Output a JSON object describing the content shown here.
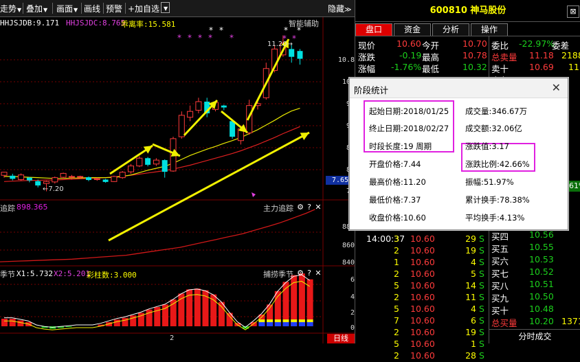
{
  "toolbar": {
    "items": [
      "走势",
      "叠加",
      "画面",
      "画线",
      "预警",
      "+加自选"
    ],
    "hide_label": "隐藏",
    "icon_names": [
      "dropdown-icon",
      "expand-icon"
    ]
  },
  "main_chart": {
    "indicators": [
      "HHJSJDB:9.171",
      "HHJSJDC:8.765",
      "乖离率:15.581"
    ],
    "smart_label": "智能辅助",
    "y_axis": [
      "10.8",
      "10.",
      "9.",
      "9.",
      "8.",
      "8.",
      "7."
    ],
    "price_tag": "7.65",
    "low_label": "7.20",
    "high_label": "11.20",
    "candles": [
      {
        "o": 7.61,
        "c": 7.69,
        "h": 7.7,
        "l": 7.55,
        "up": true
      },
      {
        "o": 7.6,
        "c": 7.52,
        "h": 7.65,
        "l": 7.48,
        "up": false
      },
      {
        "o": 7.5,
        "c": 7.62,
        "h": 7.66,
        "l": 7.47,
        "up": true
      },
      {
        "o": 7.55,
        "c": 7.48,
        "h": 7.57,
        "l": 7.43,
        "up": false
      },
      {
        "o": 7.46,
        "c": 7.35,
        "h": 7.5,
        "l": 7.3,
        "up": false
      },
      {
        "o": 7.4,
        "c": 7.45,
        "h": 7.47,
        "l": 7.2,
        "up": true
      },
      {
        "o": 7.44,
        "c": 7.55,
        "h": 7.58,
        "l": 7.4,
        "up": true
      },
      {
        "o": 7.56,
        "c": 7.66,
        "h": 7.68,
        "l": 7.52,
        "up": true
      },
      {
        "o": 7.57,
        "c": 7.58,
        "h": 7.62,
        "l": 7.5,
        "up": true
      },
      {
        "o": 7.58,
        "c": 7.58,
        "h": 7.6,
        "l": 7.52,
        "up": true
      },
      {
        "o": 7.56,
        "c": 7.49,
        "h": 7.58,
        "l": 7.46,
        "up": false
      },
      {
        "o": 7.5,
        "c": 7.52,
        "h": 7.55,
        "l": 7.47,
        "up": true
      },
      {
        "o": 7.5,
        "c": 7.44,
        "h": 7.52,
        "l": 7.42,
        "up": false
      },
      {
        "o": 7.45,
        "c": 7.58,
        "h": 7.6,
        "l": 7.44,
        "up": true
      },
      {
        "o": 7.55,
        "c": 7.69,
        "h": 7.72,
        "l": 7.52,
        "up": true
      },
      {
        "o": 7.7,
        "c": 7.85,
        "h": 7.9,
        "l": 7.65,
        "up": true
      },
      {
        "o": 7.85,
        "c": 8.05,
        "h": 8.1,
        "l": 7.82,
        "up": true
      },
      {
        "o": 8.05,
        "c": 7.88,
        "h": 8.08,
        "l": 7.84,
        "up": false
      },
      {
        "o": 7.9,
        "c": 8.0,
        "h": 8.05,
        "l": 7.85,
        "up": true
      },
      {
        "o": 8.0,
        "c": 7.7,
        "h": 8.02,
        "l": 7.55,
        "up": false
      },
      {
        "o": 7.72,
        "c": 8.55,
        "h": 8.6,
        "l": 7.7,
        "up": true
      },
      {
        "o": 8.6,
        "c": 9.15,
        "h": 9.25,
        "l": 8.55,
        "up": true
      },
      {
        "o": 9.1,
        "c": 9.25,
        "h": 9.4,
        "l": 9.0,
        "up": true
      },
      {
        "o": 9.28,
        "c": 9.5,
        "h": 9.6,
        "l": 9.2,
        "up": true
      },
      {
        "o": 9.5,
        "c": 9.2,
        "h": 9.6,
        "l": 9.1,
        "up": false
      },
      {
        "o": 9.3,
        "c": 9.48,
        "h": 9.52,
        "l": 9.25,
        "up": true
      },
      {
        "o": 9.4,
        "c": 9.35,
        "h": 9.42,
        "l": 9.28,
        "up": false
      },
      {
        "o": 9.0,
        "c": 8.6,
        "h": 9.02,
        "l": 8.55,
        "up": false
      },
      {
        "o": 8.5,
        "c": 8.8,
        "h": 8.85,
        "l": 8.4,
        "up": true
      },
      {
        "o": 8.7,
        "c": 9.4,
        "h": 9.55,
        "l": 8.65,
        "up": true
      },
      {
        "o": 9.4,
        "c": 9.45,
        "h": 9.5,
        "l": 9.3,
        "up": true
      },
      {
        "o": 9.6,
        "c": 10.35,
        "h": 10.5,
        "l": 9.55,
        "up": true
      },
      {
        "o": 10.3,
        "c": 10.85,
        "h": 10.95,
        "l": 10.25,
        "up": true
      },
      {
        "o": 10.7,
        "c": 11.0,
        "h": 11.2,
        "l": 10.65,
        "up": true
      },
      {
        "o": 10.85,
        "c": 10.65,
        "h": 10.95,
        "l": 10.5,
        "up": false
      },
      {
        "o": 10.8,
        "c": 10.6,
        "h": 10.85,
        "l": 10.45,
        "up": false
      }
    ],
    "ma_yellow": [
      7.58,
      7.58,
      7.57,
      7.56,
      7.55,
      7.54,
      7.53,
      7.53,
      7.54,
      7.54,
      7.55,
      7.55,
      7.55,
      7.56,
      7.58,
      7.62,
      7.68,
      7.74,
      7.79,
      7.84,
      7.92,
      8.02,
      8.12,
      8.2,
      8.28,
      8.35,
      8.43,
      8.5,
      8.58,
      8.68,
      8.78,
      8.9,
      9.02,
      9.15,
      9.26,
      9.33
    ],
    "ma_red": [
      7.45,
      7.46,
      7.47,
      7.48,
      7.48,
      7.49,
      7.49,
      7.5,
      7.51,
      7.52,
      7.53,
      7.54,
      7.55,
      7.57,
      7.59,
      7.61,
      7.64,
      7.67,
      7.7,
      7.73,
      7.77,
      7.82,
      7.87,
      7.93,
      7.99,
      8.05,
      8.11,
      8.17,
      8.24,
      8.32,
      8.4,
      8.49,
      8.58,
      8.68,
      8.77,
      8.86
    ],
    "y_range": [
      7.05,
      11.35
    ]
  },
  "panel2": {
    "title_left": "追踪",
    "value_left": "898.365",
    "title_right": "主力追踪",
    "y_axis": [
      "880",
      "860",
      "840"
    ],
    "line": [
      818,
      818.5,
      819,
      819.5,
      820,
      820.5,
      821,
      821.5,
      822,
      823,
      824,
      825,
      826,
      827,
      828,
      830,
      832,
      834,
      836,
      838,
      840,
      843,
      846,
      849,
      852,
      855,
      858,
      861,
      865,
      869,
      873,
      877,
      882,
      887,
      892,
      898
    ],
    "y_range": [
      816,
      902
    ]
  },
  "panel3": {
    "title_left": "季节",
    "indicators": [
      "X1:5.732",
      "X2:5.201",
      "彩柱数:3.000"
    ],
    "title_right": "捕捞季节",
    "y_axis": [
      "6",
      "4",
      "2",
      "0"
    ],
    "bars": [
      0.9,
      0.9,
      0.7,
      0.5,
      0,
      -0.2,
      -0.3,
      -0.2,
      -0.1,
      0,
      0,
      0,
      0.2,
      0.5,
      0.8,
      1.0,
      1.3,
      1.6,
      2.0,
      2.3,
      2.6,
      3.2,
      3.9,
      4.4,
      4.5,
      4.3,
      3.8,
      2.9,
      1.6,
      0.4,
      -0.3,
      0.5,
      1.4,
      2.6,
      4.2,
      5.3,
      6.1,
      6.3,
      5.6
    ],
    "x_label": "2",
    "tab": "日线"
  },
  "right_panel": {
    "code_name": "600810 神马股份",
    "tabs": [
      "盘口",
      "资金",
      "分析",
      "操作"
    ],
    "active_tab": "盘口",
    "quote_left": [
      {
        "label": "现价",
        "value": "10.60",
        "label2": "今开",
        "value2": "10.70"
      },
      {
        "label": "涨跌",
        "value": "-0.19",
        "label2": "最高",
        "value2": "10.78"
      },
      {
        "label": "涨幅",
        "value": "-1.76%",
        "label2": "最低",
        "value2": "10.32"
      }
    ],
    "quote_right": [
      {
        "label": "委比",
        "value": "-22.97%",
        "label2": "委差"
      },
      {
        "label": "总卖量",
        "value": "11.18",
        "value2": "2188"
      },
      {
        "label": "卖十",
        "value": "10.69",
        "value2": "11"
      },
      {
        "label": "卖九",
        "value": "",
        "value2": ""
      }
    ],
    "ticks": [
      {
        "time": "14:00:37",
        "n": "3",
        "price": "10.60",
        "vol": "29",
        "side": "S"
      },
      {
        "time": "",
        "n": "2",
        "price": "10.60",
        "vol": "19",
        "side": "S"
      },
      {
        "time": "",
        "n": "1",
        "price": "10.60",
        "vol": "4",
        "side": "S"
      },
      {
        "time": "",
        "n": "2",
        "price": "10.60",
        "vol": "5",
        "side": "S"
      },
      {
        "time": "",
        "n": "5",
        "price": "10.60",
        "vol": "14",
        "side": "S"
      },
      {
        "time": "",
        "n": "2",
        "price": "10.60",
        "vol": "11",
        "side": "S"
      },
      {
        "time": "",
        "n": "5",
        "price": "10.60",
        "vol": "4",
        "side": "S"
      },
      {
        "time": "",
        "n": "7",
        "price": "10.60",
        "vol": "6",
        "side": "S"
      },
      {
        "time": "",
        "n": "2",
        "price": "10.60",
        "vol": "19",
        "side": "S"
      },
      {
        "time": "",
        "n": "5",
        "price": "10.60",
        "vol": "1",
        "side": "S"
      },
      {
        "time": "",
        "n": "2",
        "price": "10.60",
        "vol": "28",
        "side": "S"
      }
    ],
    "buys": [
      {
        "label": "买四",
        "value": "10.56"
      },
      {
        "label": "买五",
        "value": "10.55"
      },
      {
        "label": "买六",
        "value": "10.53"
      },
      {
        "label": "买七",
        "value": "10.52"
      },
      {
        "label": "买八",
        "value": "10.51"
      },
      {
        "label": "买九",
        "value": "10.50"
      },
      {
        "label": "买十",
        "value": "10.48"
      },
      {
        "label": "总买量",
        "value": "10.20",
        "value2": "1371"
      }
    ],
    "pct_badge": "61%",
    "footer": "分时成交"
  },
  "dialog": {
    "title": "阶段统计",
    "left": [
      "起始日期:2018/01/25",
      "终止日期:2018/02/27",
      "时段长度:19 周期",
      "开盘价格:7.44",
      "最高价格:11.20",
      "最低价格:7.37",
      "收盘价格:10.60"
    ],
    "right": [
      "成交量:346.67万",
      "成交额:32.06亿",
      "涨跌值:3.17",
      "涨跌比例:42.66%",
      "振幅:51.97%",
      "累计换手:78.38%",
      "平均换手:4.13%"
    ]
  },
  "colors": {
    "up": "#ff3b3b",
    "down": "#00e0e0",
    "ma_yellow": "#e8e800",
    "ma_red": "#e02020",
    "arrow": "#f0f000",
    "highlight": "#e020e0",
    "grid": "#7a0000"
  }
}
